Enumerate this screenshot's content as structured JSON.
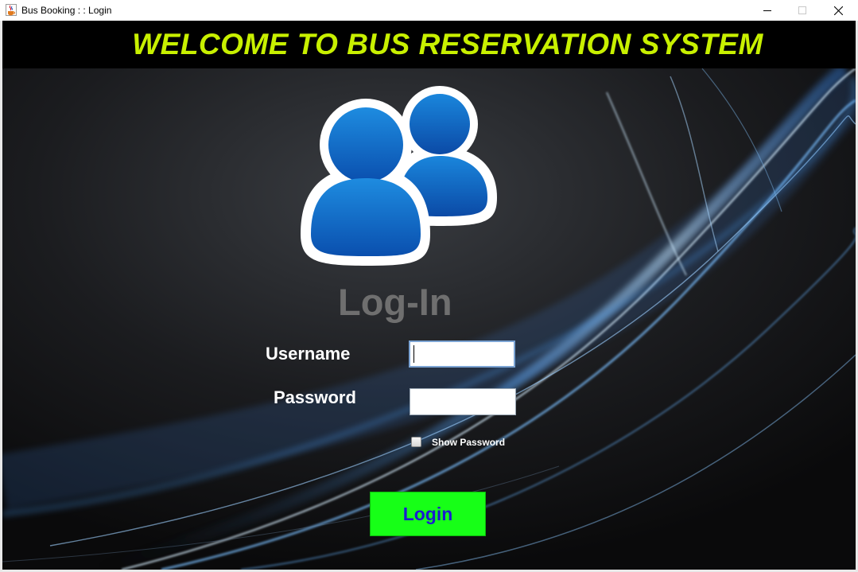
{
  "window": {
    "title": "Bus Booking : : Login",
    "controls": [
      "minimize",
      "maximize",
      "close"
    ]
  },
  "banner": {
    "title": "WELCOME TO BUS RESERVATION SYSTEM",
    "color": "#c8f000"
  },
  "login": {
    "heading": "Log-In",
    "username_label": "Username",
    "username_value": "",
    "password_label": "Password",
    "password_value": "",
    "show_password_label": "Show Password",
    "show_password_checked": false,
    "button_label": "Login",
    "button_color": "#17ff17",
    "button_text_color": "#1b1bd0"
  },
  "icons": {
    "app": "java-cup-icon",
    "users": "users-icon"
  }
}
